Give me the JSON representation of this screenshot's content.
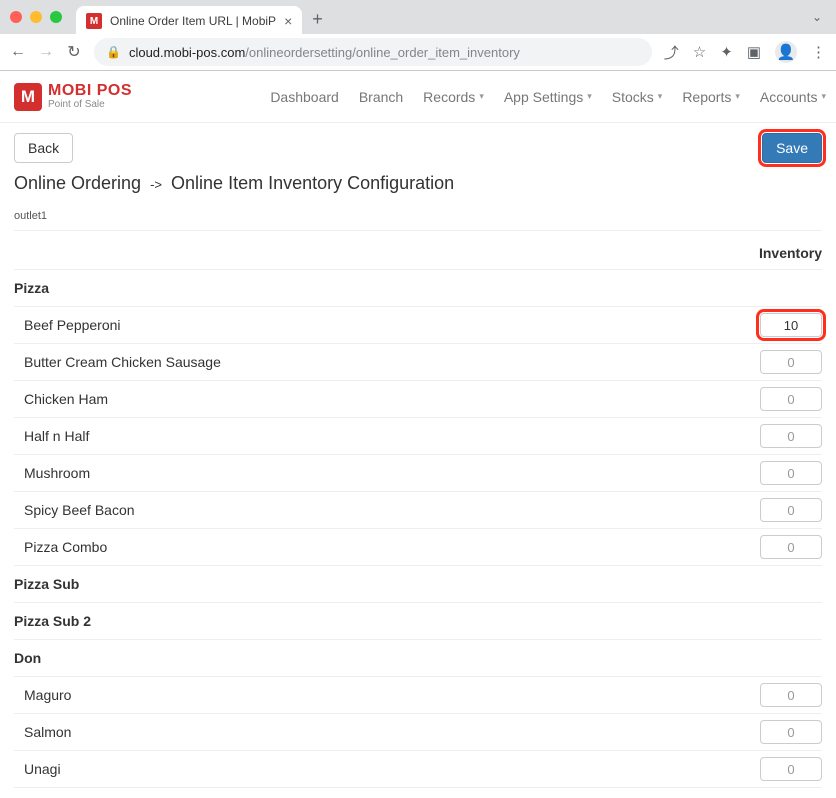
{
  "browser": {
    "tab_title": "Online Order Item URL | MobiP",
    "url_host": "cloud.mobi-pos.com",
    "url_path": "/onlineordersetting/online_order_item_inventory"
  },
  "logo": {
    "mark": "M",
    "title": "MOBI POS",
    "sub": "Point of Sale"
  },
  "nav": {
    "items": [
      {
        "label": "Dashboard",
        "dropdown": false
      },
      {
        "label": "Branch",
        "dropdown": false
      },
      {
        "label": "Records",
        "dropdown": true
      },
      {
        "label": "App Settings",
        "dropdown": true
      },
      {
        "label": "Stocks",
        "dropdown": true
      },
      {
        "label": "Reports",
        "dropdown": true
      },
      {
        "label": "Accounts",
        "dropdown": true
      }
    ]
  },
  "page": {
    "back_label": "Back",
    "save_label": "Save",
    "breadcrumb_a": "Online Ordering",
    "breadcrumb_sep": "->",
    "breadcrumb_b": "Online Item Inventory Configuration",
    "outlet": "outlet1",
    "inventory_header": "Inventory"
  },
  "categories": [
    {
      "name": "Pizza",
      "items": [
        {
          "name": "Beef Pepperoni",
          "value": "10",
          "highlighted": true
        },
        {
          "name": "Butter Cream Chicken Sausage",
          "value": "0"
        },
        {
          "name": "Chicken Ham",
          "value": "0"
        },
        {
          "name": "Half n Half",
          "value": "0"
        },
        {
          "name": "Mushroom",
          "value": "0"
        },
        {
          "name": "Spicy Beef Bacon",
          "value": "0"
        },
        {
          "name": "Pizza Combo",
          "value": "0"
        }
      ]
    },
    {
      "name": "Pizza Sub",
      "items": []
    },
    {
      "name": "Pizza Sub 2",
      "items": []
    },
    {
      "name": "Don",
      "items": [
        {
          "name": "Maguro",
          "value": "0"
        },
        {
          "name": "Salmon",
          "value": "0"
        },
        {
          "name": "Unagi",
          "value": "0"
        }
      ]
    }
  ]
}
